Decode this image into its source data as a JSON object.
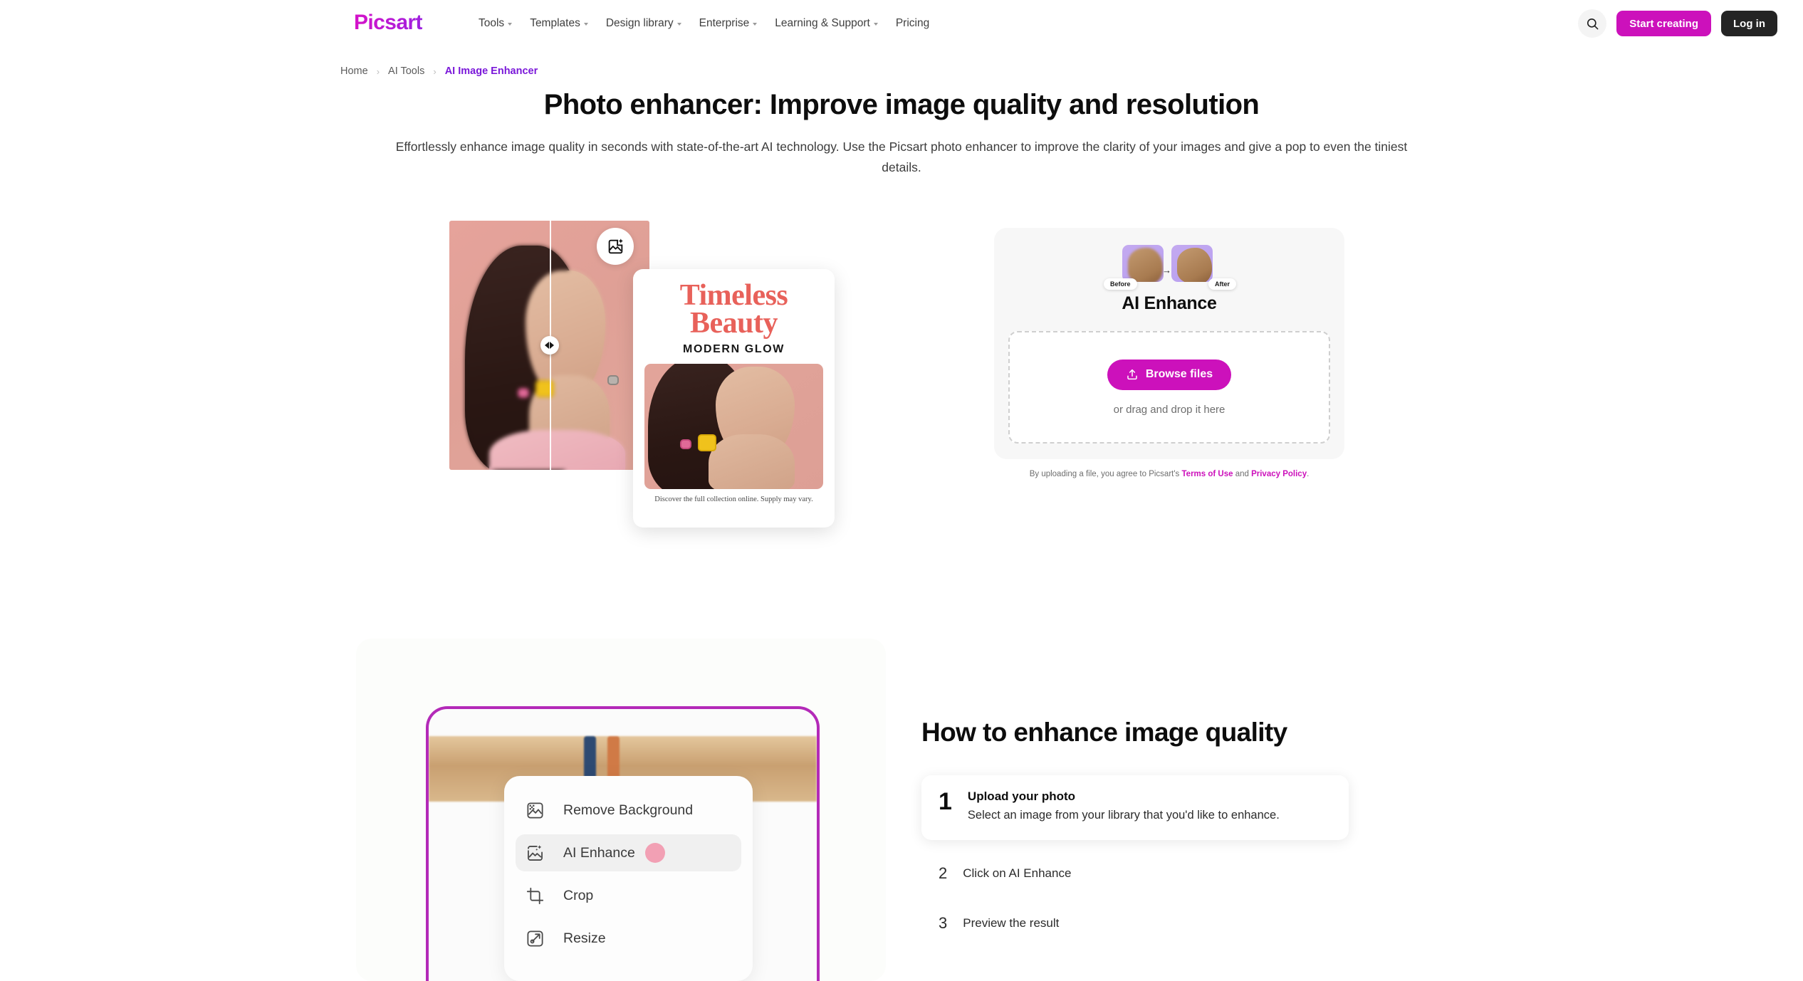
{
  "navbar": {
    "logo_text": "Picsart",
    "links": [
      {
        "label": "Tools",
        "has_caret": true
      },
      {
        "label": "Templates",
        "has_caret": true
      },
      {
        "label": "Design library",
        "has_caret": true
      },
      {
        "label": "Enterprise",
        "has_caret": true
      },
      {
        "label": "Learning & Support",
        "has_caret": true
      },
      {
        "label": "Pricing",
        "has_caret": false
      }
    ],
    "search_icon": "search-icon",
    "start_creating_label": "Start creating",
    "login_label": "Log in"
  },
  "breadcrumb": {
    "items": [
      {
        "label": "Home",
        "active": false
      },
      {
        "label": "AI Tools",
        "active": false
      },
      {
        "label": "AI Image Enhancer",
        "active": true
      }
    ],
    "separator": "›"
  },
  "hero": {
    "title": "Photo enhancer: Improve image quality and resolution",
    "subtitle": "Effortlessly enhance image quality in seconds with state-of-the-art AI technology. Use the Picsart photo enhancer to improve the clarity of your images and give a pop to even the tiniest details.",
    "badge_icon": "ai-image-enhance-icon",
    "slider_handle_icon": "compare-slider-handle-icon",
    "poster": {
      "title_line1": "Timeless",
      "title_line2": "Beauty",
      "subtitle": "MODERN GLOW",
      "caption": "Discover the full collection online. Supply may vary."
    }
  },
  "upload_card": {
    "before_label": "Before",
    "after_label": "After",
    "arrow_glyph": "→",
    "title": "AI Enhance",
    "browse_label": "Browse files",
    "upload_icon": "upload-icon",
    "drag_hint": "or drag and drop it here",
    "legal_prefix": "By uploading a file, you agree to Picsart's ",
    "legal_terms": "Terms of Use",
    "legal_middle": " and ",
    "legal_privacy": "Privacy Policy",
    "legal_suffix": "."
  },
  "app_preview": {
    "menu": [
      {
        "label": "Remove Background",
        "icon": "remove-background-icon",
        "active": false
      },
      {
        "label": "AI Enhance",
        "icon": "ai-enhance-icon",
        "active": true
      },
      {
        "label": "Crop",
        "icon": "crop-icon",
        "active": false
      },
      {
        "label": "Resize",
        "icon": "resize-icon",
        "active": false
      }
    ]
  },
  "how_to": {
    "title": "How to enhance image quality",
    "steps": [
      {
        "number": "1",
        "heading": "Upload your photo",
        "description": "Select an image from your library that you'd like to enhance.",
        "highlighted": true
      },
      {
        "number": "2",
        "heading": "Click on AI Enhance",
        "description": "",
        "highlighted": false
      },
      {
        "number": "3",
        "heading": "Preview the result",
        "description": "",
        "highlighted": false
      }
    ]
  },
  "colors": {
    "brand_magenta": "#cc11bb",
    "brand_purple": "#7a18d9",
    "dark_button": "#242424",
    "card_bg": "#f7f7f7",
    "phone_border": "#b32ab8",
    "poster_red": "#e8615a",
    "cursor_pink": "#f2a0b4"
  }
}
